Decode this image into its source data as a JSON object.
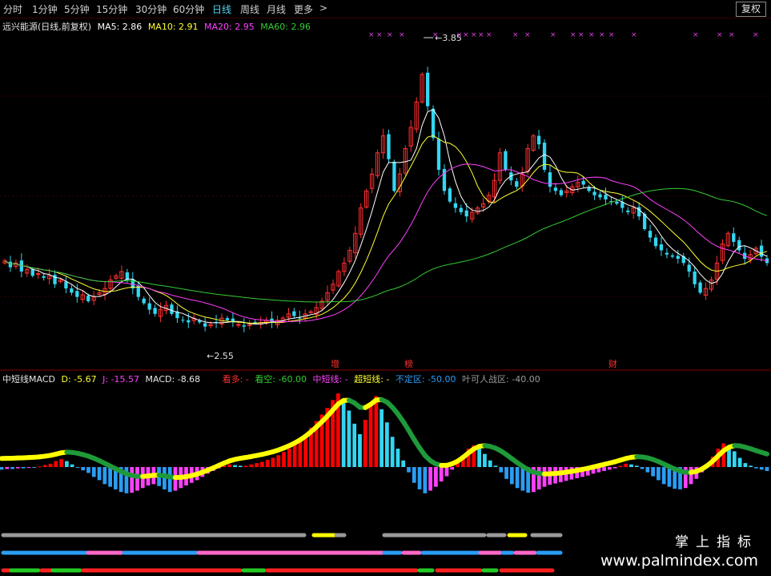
{
  "toolbar": {
    "tabs": [
      "分时",
      "1分钟",
      "5分钟",
      "15分钟",
      "30分钟",
      "60分钟",
      "日线",
      "周线",
      "月线",
      "更多"
    ],
    "active": "日线",
    "more_arrow": ">",
    "fq_label": "复权"
  },
  "main_legend": {
    "name": "远兴能源(日线,前复权)",
    "ma5": "MA5: 2.86",
    "ma10": "MA10: 2.91",
    "ma20": "MA20: 2.95",
    "ma60": "MA60: 2.96"
  },
  "colors": {
    "up": "#ff3030",
    "down": "#33d6f2",
    "ma5": "#ffffff",
    "ma10": "#ffff33",
    "ma20": "#ff40ff",
    "ma60": "#33cc33",
    "divider": "#8a0000",
    "band_pos": "#ff0000",
    "band_neg": "#ff40ff",
    "neg_blue": "#2a9df4",
    "yellow": "#ffff00",
    "green_band": "#1e9a3a"
  },
  "annotations": {
    "high_label": "3.85",
    "low_label": "2.55",
    "markers": [
      "增",
      "榜",
      "财"
    ]
  },
  "macd_legend": {
    "name": "中短线MACD",
    "d": "D: -5.67",
    "j": "J: -15.57",
    "macd": "MACD: -8.68",
    "kd": "看多: -",
    "kk": "看空: -60.00",
    "zdx": "中短线: -",
    "cdx": "超短线: -",
    "bdq": "不定区: -50.00",
    "ykr": "叶可人战区: -40.00"
  },
  "watermark": {
    "cn": "掌上指标",
    "url": "www.palmindex.com"
  },
  "chart_data": [
    {
      "type": "candlestick",
      "title": "远兴能源(日线,前复权)",
      "series": [
        "MA5",
        "MA10",
        "MA20",
        "MA60"
      ],
      "ylim": [
        2.4,
        3.95
      ],
      "annotations": [
        {
          "label": "3.85",
          "kind": "high"
        },
        {
          "label": "2.55",
          "kind": "low"
        }
      ],
      "close": [
        2.87,
        2.84,
        2.86,
        2.82,
        2.83,
        2.8,
        2.81,
        2.79,
        2.8,
        2.76,
        2.78,
        2.74,
        2.72,
        2.7,
        2.71,
        2.68,
        2.7,
        2.72,
        2.74,
        2.78,
        2.8,
        2.82,
        2.78,
        2.74,
        2.7,
        2.67,
        2.64,
        2.62,
        2.64,
        2.66,
        2.62,
        2.6,
        2.59,
        2.58,
        2.6,
        2.58,
        2.56,
        2.57,
        2.58,
        2.6,
        2.59,
        2.58,
        2.57,
        2.56,
        2.57,
        2.58,
        2.58,
        2.59,
        2.58,
        2.59,
        2.6,
        2.62,
        2.61,
        2.6,
        2.62,
        2.63,
        2.65,
        2.68,
        2.72,
        2.76,
        2.82,
        2.86,
        2.92,
        3.0,
        3.12,
        3.2,
        3.28,
        3.38,
        3.46,
        3.35,
        3.2,
        3.28,
        3.4,
        3.5,
        3.62,
        3.75,
        3.6,
        3.45,
        3.3,
        3.2,
        3.15,
        3.12,
        3.1,
        3.08,
        3.1,
        3.12,
        3.14,
        3.18,
        3.25,
        3.38,
        3.3,
        3.25,
        3.22,
        3.28,
        3.4,
        3.46,
        3.42,
        3.3,
        3.22,
        3.2,
        3.18,
        3.2,
        3.22,
        3.24,
        3.23,
        3.2,
        3.18,
        3.17,
        3.16,
        3.15,
        3.14,
        3.12,
        3.1,
        3.12,
        3.08,
        3.02,
        2.98,
        2.94,
        2.92,
        2.9,
        2.89,
        2.88,
        2.86,
        2.82,
        2.76,
        2.72,
        2.74,
        2.78,
        2.86,
        2.95,
        3.0,
        2.96,
        2.92,
        2.88,
        2.9,
        2.93,
        2.89,
        2.86
      ]
    },
    {
      "type": "bar",
      "title": "中短线MACD",
      "series": [
        {
          "name": "MACD",
          "values": [
            -0.4,
            -0.3,
            -0.3,
            -0.2,
            -0.2,
            -0.1,
            -0.1,
            0.1,
            0.3,
            0.5,
            0.9,
            1.2,
            0.9,
            0.4,
            -0.1,
            -0.5,
            -0.9,
            -1.5,
            -2.0,
            -2.6,
            -3.0,
            -3.4,
            -3.8,
            -4.0,
            -3.9,
            -3.6,
            -3.2,
            -2.8,
            -2.6,
            -2.9,
            -3.4,
            -3.8,
            -3.6,
            -3.2,
            -2.8,
            -2.4,
            -2.0,
            -1.5,
            -1.0,
            -0.6,
            -0.2,
            0.2,
            0.4,
            0.3,
            0.2,
            0.2,
            0.4,
            0.6,
            0.8,
            1.1,
            1.4,
            1.8,
            2.3,
            2.8,
            3.4,
            4.1,
            5.0,
            6.0,
            7.0,
            8.0,
            9.0,
            10.2,
            11.2,
            10.4,
            8.6,
            6.6,
            5.0,
            7.2,
            9.6,
            10.8,
            8.8,
            6.8,
            4.6,
            2.8,
            1.0,
            -0.8,
            -2.4,
            -3.4,
            -4.0,
            -3.6,
            -3.0,
            -2.2,
            -1.4,
            -0.4,
            0.6,
            1.8,
            2.8,
            3.3,
            2.8,
            2.0,
            1.0,
            0.2,
            -0.8,
            -1.8,
            -2.6,
            -3.2,
            -3.6,
            -3.9,
            -3.8,
            -3.4,
            -3.0,
            -2.7,
            -2.5,
            -2.3,
            -2.1,
            -1.9,
            -1.7,
            -1.5,
            -1.3,
            -1.0,
            -0.8,
            -0.6,
            -0.4,
            -0.2,
            0.2,
            0.5,
            0.4,
            0.2,
            -0.3,
            -0.8,
            -1.4,
            -2.0,
            -2.6,
            -3.0,
            -3.3,
            -3.4,
            -3.2,
            -2.6,
            -1.8,
            -0.8,
            0.4,
            1.6,
            2.8,
            3.6,
            3.2,
            2.4,
            1.4,
            0.6,
            0.2,
            -0.2,
            -0.4,
            -0.6
          ]
        }
      ]
    }
  ]
}
